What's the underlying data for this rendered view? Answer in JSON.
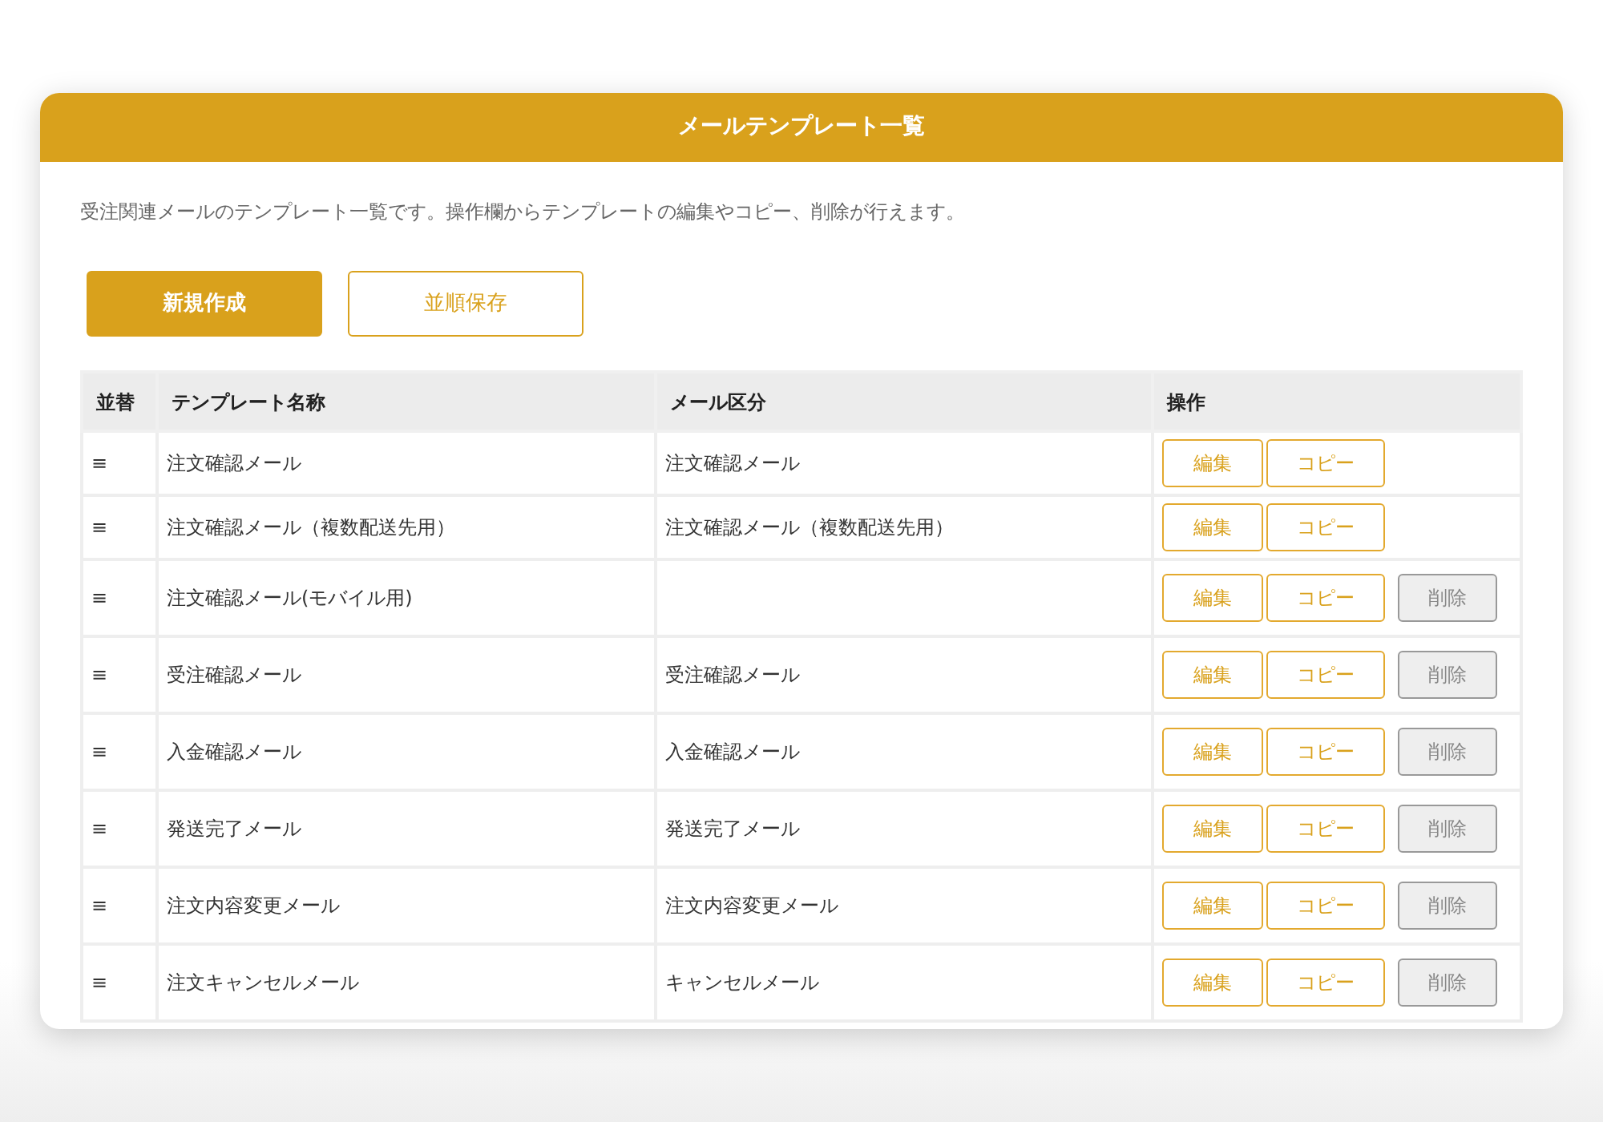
{
  "panel": {
    "title": "メールテンプレート一覧",
    "description": "受注関連メールのテンプレート一覧です。操作欄からテンプレートの編集やコピー、削除が行えます。"
  },
  "toolbar": [
    {
      "label": "新規作成",
      "kind": "primary"
    },
    {
      "label": "並順保存",
      "kind": "outline"
    }
  ],
  "table": {
    "columns": [
      "並替",
      "テンプレート名称",
      "メール区分",
      "操作"
    ],
    "rows": [
      {
        "handle": "≡",
        "name": "注文確認メール",
        "category": "注文確認メール",
        "actions": [
          {
            "label": "編集",
            "kind": "edit"
          },
          {
            "label": "コピー",
            "kind": "copy"
          }
        ]
      },
      {
        "handle": "≡",
        "name": "注文確認メール（複数配送先用）",
        "category": "注文確認メール（複数配送先用）",
        "actions": [
          {
            "label": "編集",
            "kind": "edit"
          },
          {
            "label": "コピー",
            "kind": "copy"
          }
        ]
      },
      {
        "handle": "≡",
        "name": "注文確認メール(モバイル用)",
        "actions": [
          {
            "label": "編集",
            "kind": "edit"
          },
          {
            "label": "コピー",
            "kind": "copy"
          },
          {
            "label": "削除",
            "kind": "delete"
          }
        ]
      },
      {
        "handle": "≡",
        "name": "受注確認メール",
        "category": "受注確認メール",
        "actions": [
          {
            "label": "編集",
            "kind": "edit"
          },
          {
            "label": "コピー",
            "kind": "copy"
          },
          {
            "label": "削除",
            "kind": "delete"
          }
        ]
      },
      {
        "handle": "≡",
        "name": "入金確認メール",
        "category": "入金確認メール",
        "actions": [
          {
            "label": "編集",
            "kind": "edit"
          },
          {
            "label": "コピー",
            "kind": "copy"
          },
          {
            "label": "削除",
            "kind": "delete"
          }
        ]
      },
      {
        "handle": "≡",
        "name": "発送完了メール",
        "category": "発送完了メール",
        "actions": [
          {
            "label": "編集",
            "kind": "edit"
          },
          {
            "label": "コピー",
            "kind": "copy"
          },
          {
            "label": "削除",
            "kind": "delete"
          }
        ]
      },
      {
        "handle": "≡",
        "name": "注文内容変更メール",
        "category": "注文内容変更メール",
        "actions": [
          {
            "label": "編集",
            "kind": "edit"
          },
          {
            "label": "コピー",
            "kind": "copy"
          },
          {
            "label": "削除",
            "kind": "delete"
          }
        ]
      },
      {
        "handle": "≡",
        "name": "注文キャンセルメール",
        "category": "キャンセルメール",
        "actions": [
          {
            "label": "編集",
            "kind": "edit"
          },
          {
            "label": "コピー",
            "kind": "copy"
          },
          {
            "label": "削除",
            "kind": "delete"
          }
        ]
      }
    ]
  }
}
